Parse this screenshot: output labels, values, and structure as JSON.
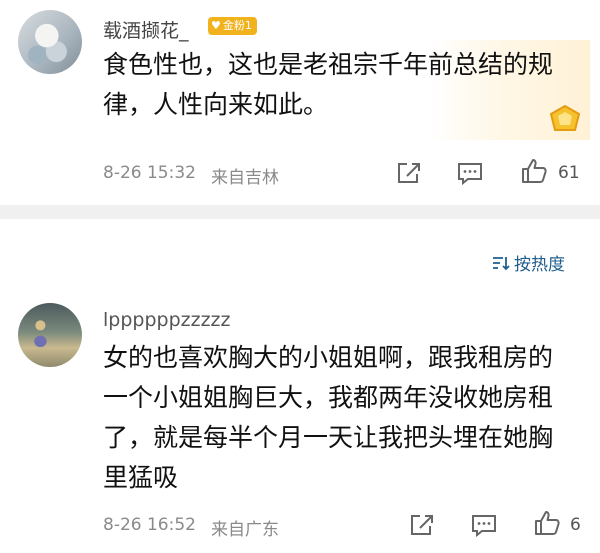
{
  "comments": [
    {
      "username": "载酒撷花_",
      "badge": "金粉1",
      "text": "食色性也，这也是老祖宗千年前总结的规律，人性向来如此。",
      "timestamp": "8-26 15:32",
      "location": "来自吉林",
      "likes": "61"
    },
    {
      "username": "lppppppzzzzz",
      "text": "女的也喜欢胸大的小姐姐啊，跟我租房的一个小姐姐胸巨大，我都两年没收她房租了，就是每半个月一天让我把头埋在她胸里猛吸",
      "timestamp": "8-26 16:52",
      "location": "来自广东",
      "likes": "6"
    }
  ],
  "sort": {
    "label": "按热度"
  },
  "colors": {
    "badge": "#f2b21d",
    "sort_link": "#1f5f8f",
    "divider": "#f0f0f0"
  }
}
